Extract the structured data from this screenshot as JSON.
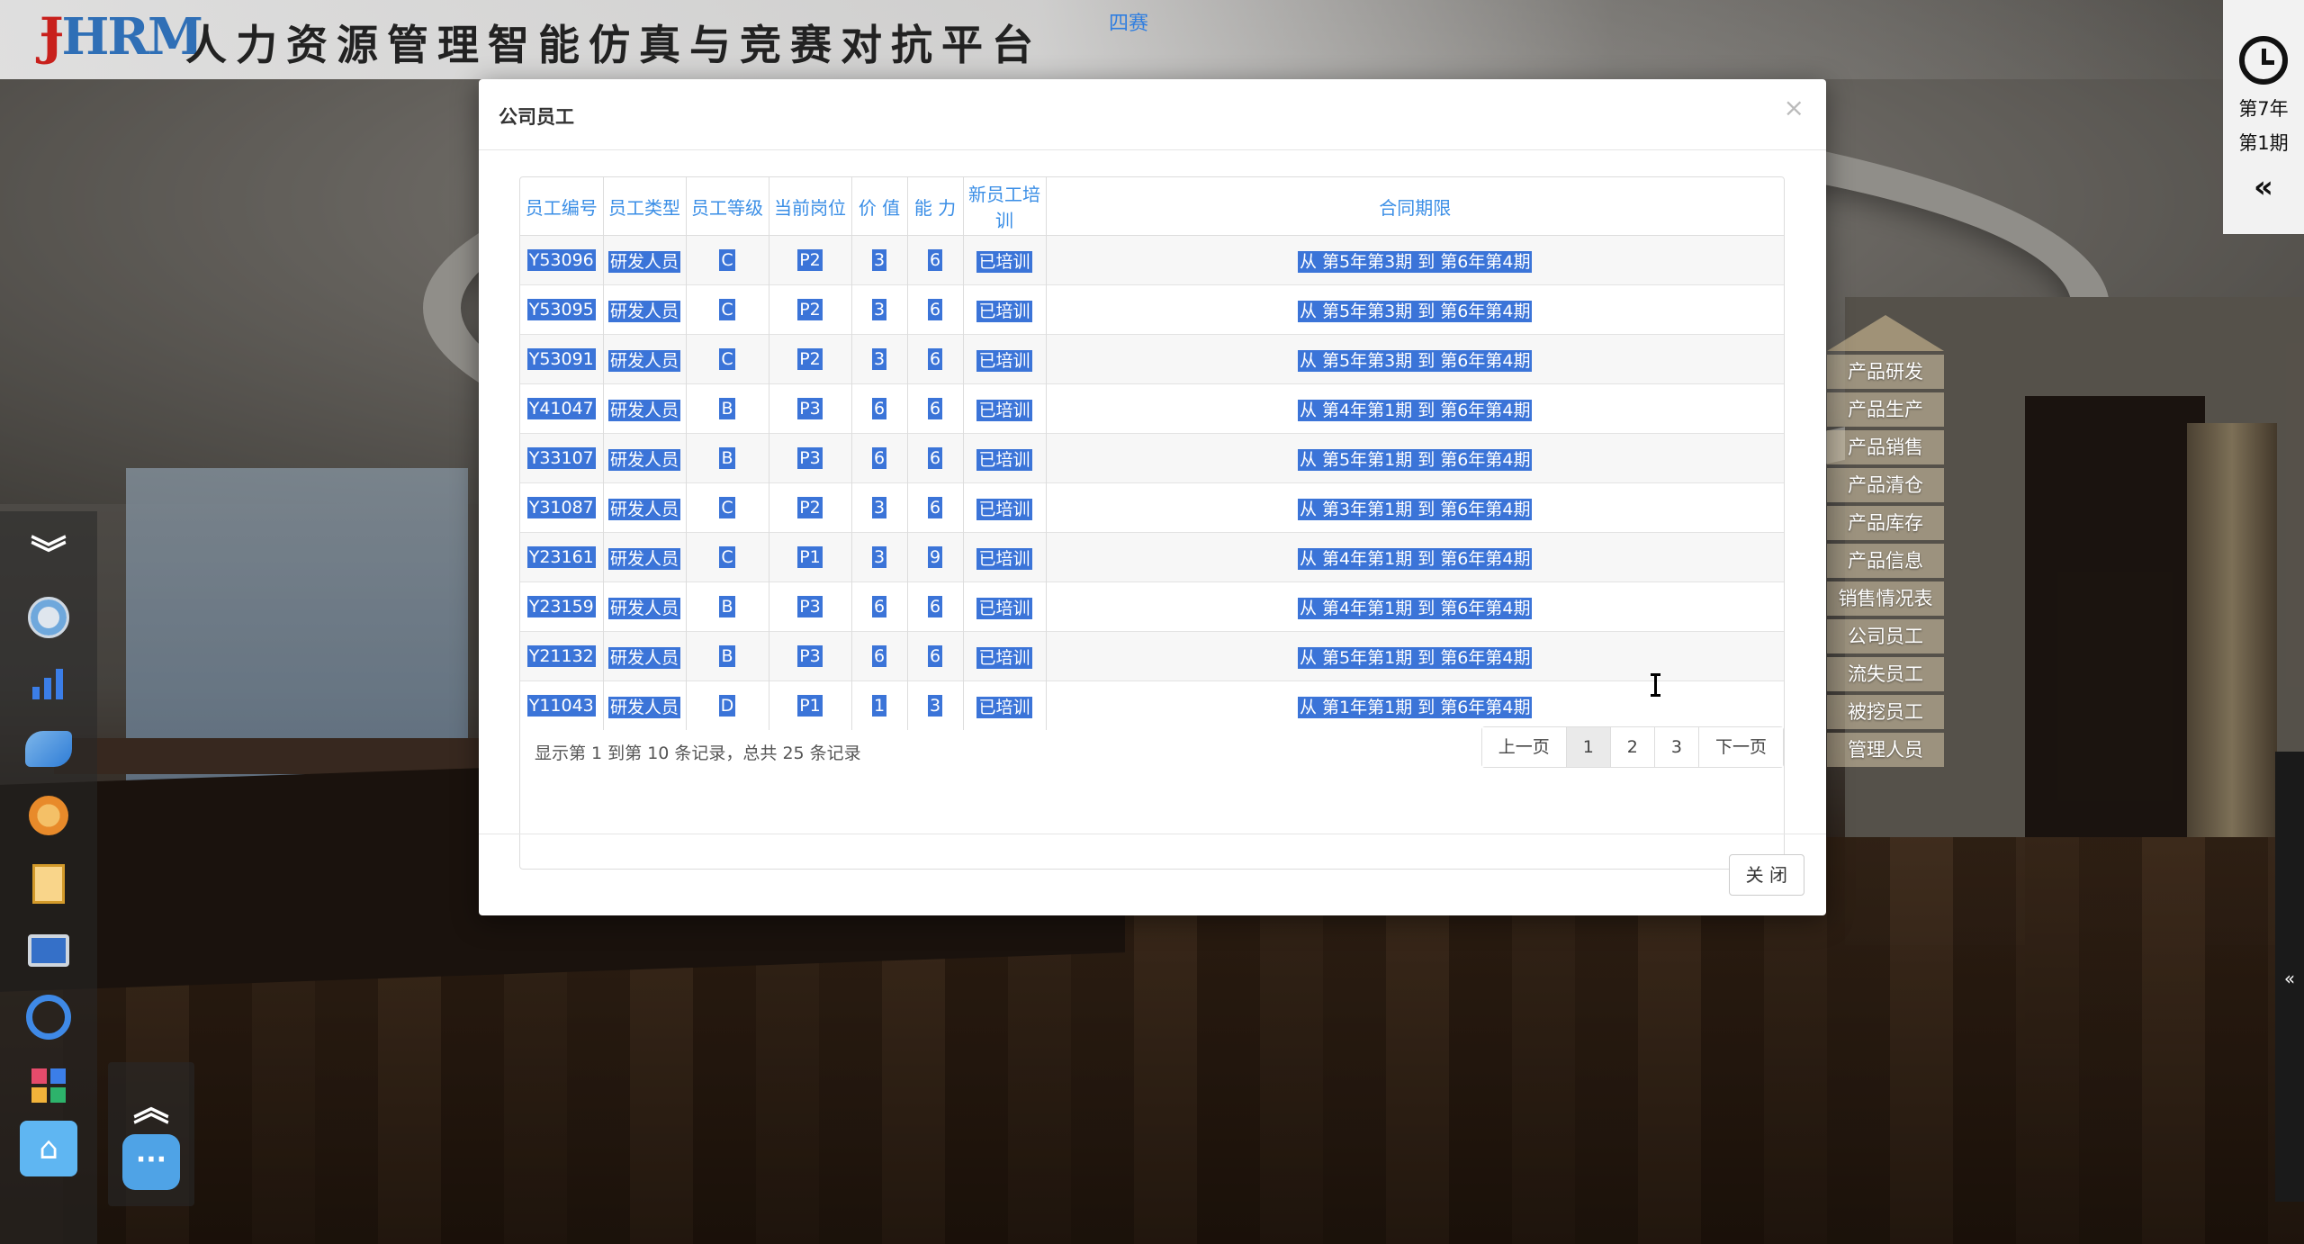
{
  "header": {
    "logo": "HRM",
    "title": "人力资源管理智能仿真与竞赛对抗平台",
    "badge": "四赛"
  },
  "clock": {
    "year": "第7年",
    "term": "第1期",
    "collapse": "«"
  },
  "right_menu": [
    "产品研发",
    "产品生产",
    "产品销售",
    "产品清仓",
    "产品库存",
    "产品信息",
    "销售情况表",
    "公司员工",
    "流失员工",
    "被挖员工",
    "管理人员"
  ],
  "edge_toggle": "«",
  "left_toolbar": [
    "chevrons-down-icon",
    "cube-icon",
    "bar-chart-icon",
    "handshake-icon",
    "gear-head-icon",
    "document-icon",
    "film-icon",
    "ring-icon",
    "grid-icon",
    "home-icon"
  ],
  "modal": {
    "title": "公司员工",
    "close_symbol": "×",
    "columns": [
      "员工编号",
      "员工类型",
      "员工等级",
      "当前岗位",
      "价 值",
      "能 力",
      "新员工培训",
      "合同期限"
    ],
    "rows": [
      [
        "Y53096",
        "研发人员",
        "C",
        "P2",
        "3",
        "6",
        "已培训",
        "从 第5年第3期 到 第6年第4期"
      ],
      [
        "Y53095",
        "研发人员",
        "C",
        "P2",
        "3",
        "6",
        "已培训",
        "从 第5年第3期 到 第6年第4期"
      ],
      [
        "Y53091",
        "研发人员",
        "C",
        "P2",
        "3",
        "6",
        "已培训",
        "从 第5年第3期 到 第6年第4期"
      ],
      [
        "Y41047",
        "研发人员",
        "B",
        "P3",
        "6",
        "6",
        "已培训",
        "从 第4年第1期 到 第6年第4期"
      ],
      [
        "Y33107",
        "研发人员",
        "B",
        "P3",
        "6",
        "6",
        "已培训",
        "从 第5年第1期 到 第6年第4期"
      ],
      [
        "Y31087",
        "研发人员",
        "C",
        "P2",
        "3",
        "6",
        "已培训",
        "从 第3年第1期 到 第6年第4期"
      ],
      [
        "Y23161",
        "研发人员",
        "C",
        "P1",
        "3",
        "9",
        "已培训",
        "从 第4年第1期 到 第6年第4期"
      ],
      [
        "Y23159",
        "研发人员",
        "B",
        "P3",
        "6",
        "6",
        "已培训",
        "从 第4年第1期 到 第6年第4期"
      ],
      [
        "Y21132",
        "研发人员",
        "B",
        "P3",
        "6",
        "6",
        "已培训",
        "从 第5年第1期 到 第6年第4期"
      ],
      [
        "Y11043",
        "研发人员",
        "D",
        "P1",
        "1",
        "3",
        "已培训",
        "从 第1年第1期 到 第6年第4期"
      ]
    ],
    "summary": "显示第 1 到第 10 条记录，总共 25 条记录",
    "pager": {
      "prev": "上一页",
      "pages": [
        "1",
        "2",
        "3"
      ],
      "active_page": "1",
      "next": "下一页"
    },
    "close_button": "关 闭"
  },
  "colors": {
    "header_link": "#3a8ee6",
    "selection": "#3b74d8",
    "home_button": "#5fb6f2"
  }
}
